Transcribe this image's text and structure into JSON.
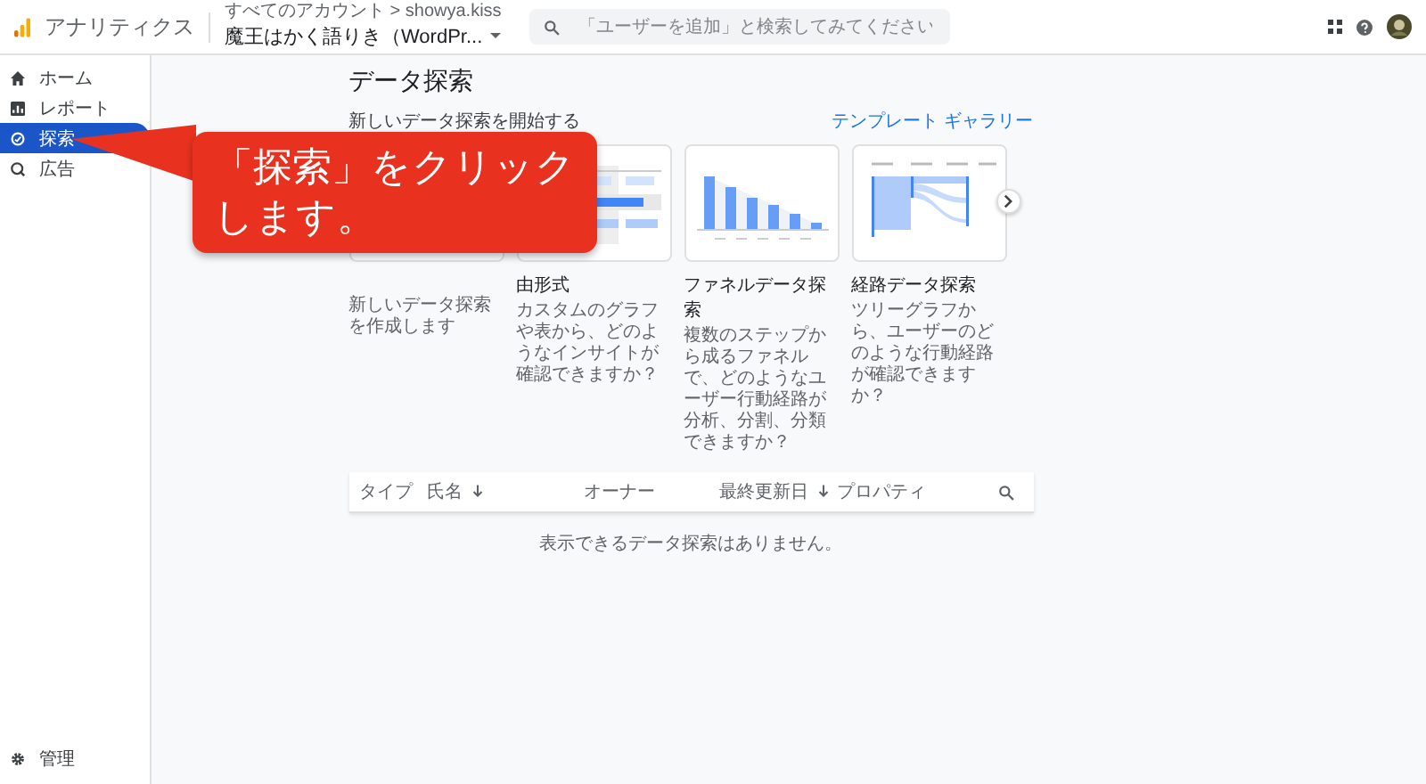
{
  "app": {
    "name": "アナリティクス"
  },
  "account": {
    "breadcrumb": "すべてのアカウント > showya.kiss",
    "property": "魔王はかく語りき（WordPr..."
  },
  "search": {
    "placeholder": "「ユーザーを追加」と検索してみてください"
  },
  "sidebar": {
    "items": [
      {
        "kind": "home",
        "label": "ホーム",
        "selected": false
      },
      {
        "kind": "report",
        "label": "レポート",
        "selected": false
      },
      {
        "kind": "explore",
        "label": "探索",
        "selected": true
      },
      {
        "kind": "ads",
        "label": "広告",
        "selected": false
      }
    ],
    "footer": {
      "label": "管理"
    }
  },
  "main": {
    "title": "データ探索",
    "subtitle": "新しいデータ探索を開始する",
    "gallery_link": "テンプレート ギャラリー",
    "cards": [
      {
        "kind": "blank",
        "description": "新しいデータ探索を作成します"
      },
      {
        "kind": "freeform",
        "title": "由形式",
        "description": "カスタムのグラフや表から、どのようなインサイトが確認できますか？"
      },
      {
        "kind": "funnel",
        "title": "ファネルデータ探索",
        "description": "複数のステップから成るファネルで、どのようなユーザー行動経路が分析、分割、分類できますか？"
      },
      {
        "kind": "path",
        "title": "経路データ探索",
        "description": "ツリーグラフから、ユーザーのどのような行動経路が確認できますか？"
      }
    ],
    "table": {
      "columns": [
        {
          "label": "タイプ",
          "sort_arrow": false
        },
        {
          "label": "氏名",
          "sort_arrow": true
        },
        {
          "label": "オーナー",
          "sort_arrow": false
        },
        {
          "label": "最終更新日",
          "sort_arrow": true
        },
        {
          "label": "プロパティ",
          "sort_arrow": false
        }
      ],
      "empty_message": "表示できるデータ探索はありません。"
    }
  },
  "callout": {
    "lines": [
      "「探索」をクリック",
      "します。"
    ]
  }
}
